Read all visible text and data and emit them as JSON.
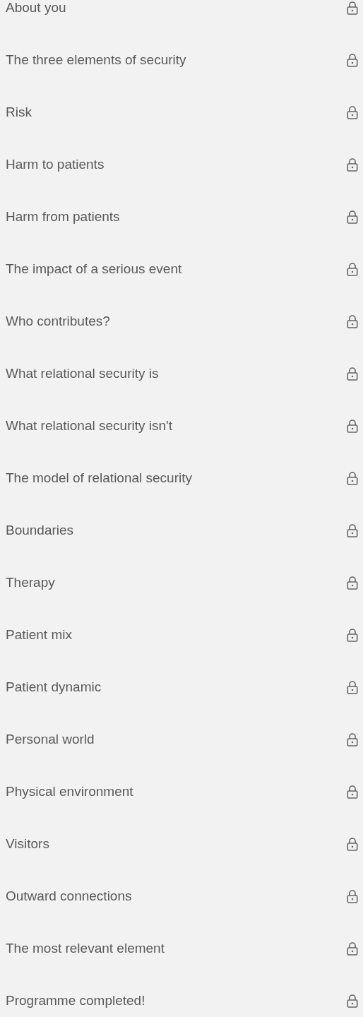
{
  "lessons": [
    {
      "title": "About you",
      "locked": true
    },
    {
      "title": "The three elements of security",
      "locked": true
    },
    {
      "title": "Risk",
      "locked": true
    },
    {
      "title": "Harm to patients",
      "locked": true
    },
    {
      "title": "Harm from patients",
      "locked": true
    },
    {
      "title": "The impact of a serious event",
      "locked": true
    },
    {
      "title": "Who contributes?",
      "locked": true
    },
    {
      "title": "What relational security is",
      "locked": true
    },
    {
      "title": "What relational security isn't",
      "locked": true
    },
    {
      "title": "The model of relational security",
      "locked": true
    },
    {
      "title": "Boundaries",
      "locked": true
    },
    {
      "title": "Therapy",
      "locked": true
    },
    {
      "title": "Patient mix",
      "locked": true
    },
    {
      "title": "Patient dynamic",
      "locked": true
    },
    {
      "title": "Personal world",
      "locked": true
    },
    {
      "title": "Physical environment",
      "locked": true
    },
    {
      "title": "Visitors",
      "locked": true
    },
    {
      "title": "Outward connections",
      "locked": true
    },
    {
      "title": "The most relevant element",
      "locked": true
    },
    {
      "title": "Programme completed!",
      "locked": true
    }
  ]
}
